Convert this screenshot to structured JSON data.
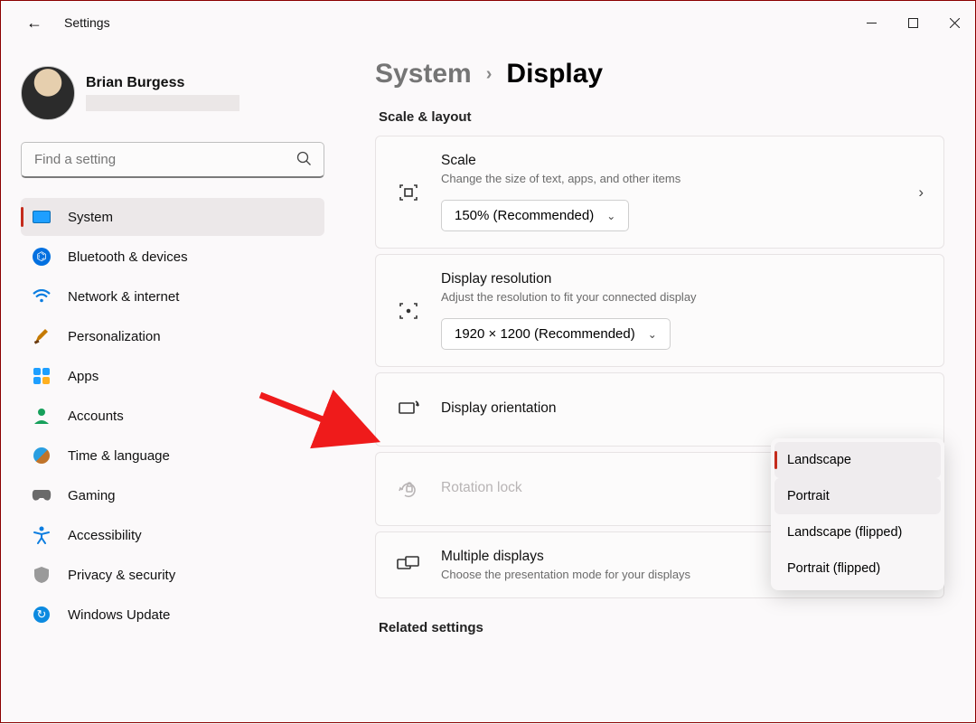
{
  "window": {
    "app_title": "Settings"
  },
  "user": {
    "name": "Brian Burgess"
  },
  "search": {
    "placeholder": "Find a setting"
  },
  "nav": {
    "items": [
      {
        "label": "System"
      },
      {
        "label": "Bluetooth & devices"
      },
      {
        "label": "Network & internet"
      },
      {
        "label": "Personalization"
      },
      {
        "label": "Apps"
      },
      {
        "label": "Accounts"
      },
      {
        "label": "Time & language"
      },
      {
        "label": "Gaming"
      },
      {
        "label": "Accessibility"
      },
      {
        "label": "Privacy & security"
      },
      {
        "label": "Windows Update"
      }
    ]
  },
  "crumb": {
    "parent": "System",
    "sep": "›",
    "child": "Display"
  },
  "section": {
    "scale_layout": "Scale & layout",
    "related": "Related settings"
  },
  "cards": {
    "scale": {
      "title": "Scale",
      "desc": "Change the size of text, apps, and other items",
      "value": "150% (Recommended)"
    },
    "resolution": {
      "title": "Display resolution",
      "desc": "Adjust the resolution to fit your connected display",
      "value": "1920 × 1200 (Recommended)"
    },
    "orientation": {
      "title": "Display orientation"
    },
    "rotation": {
      "title": "Rotation lock"
    },
    "multi": {
      "title": "Multiple displays",
      "desc": "Choose the presentation mode for your displays"
    }
  },
  "orient_menu": {
    "opt0": "Landscape",
    "opt1": "Portrait",
    "opt2": "Landscape (flipped)",
    "opt3": "Portrait (flipped)"
  }
}
